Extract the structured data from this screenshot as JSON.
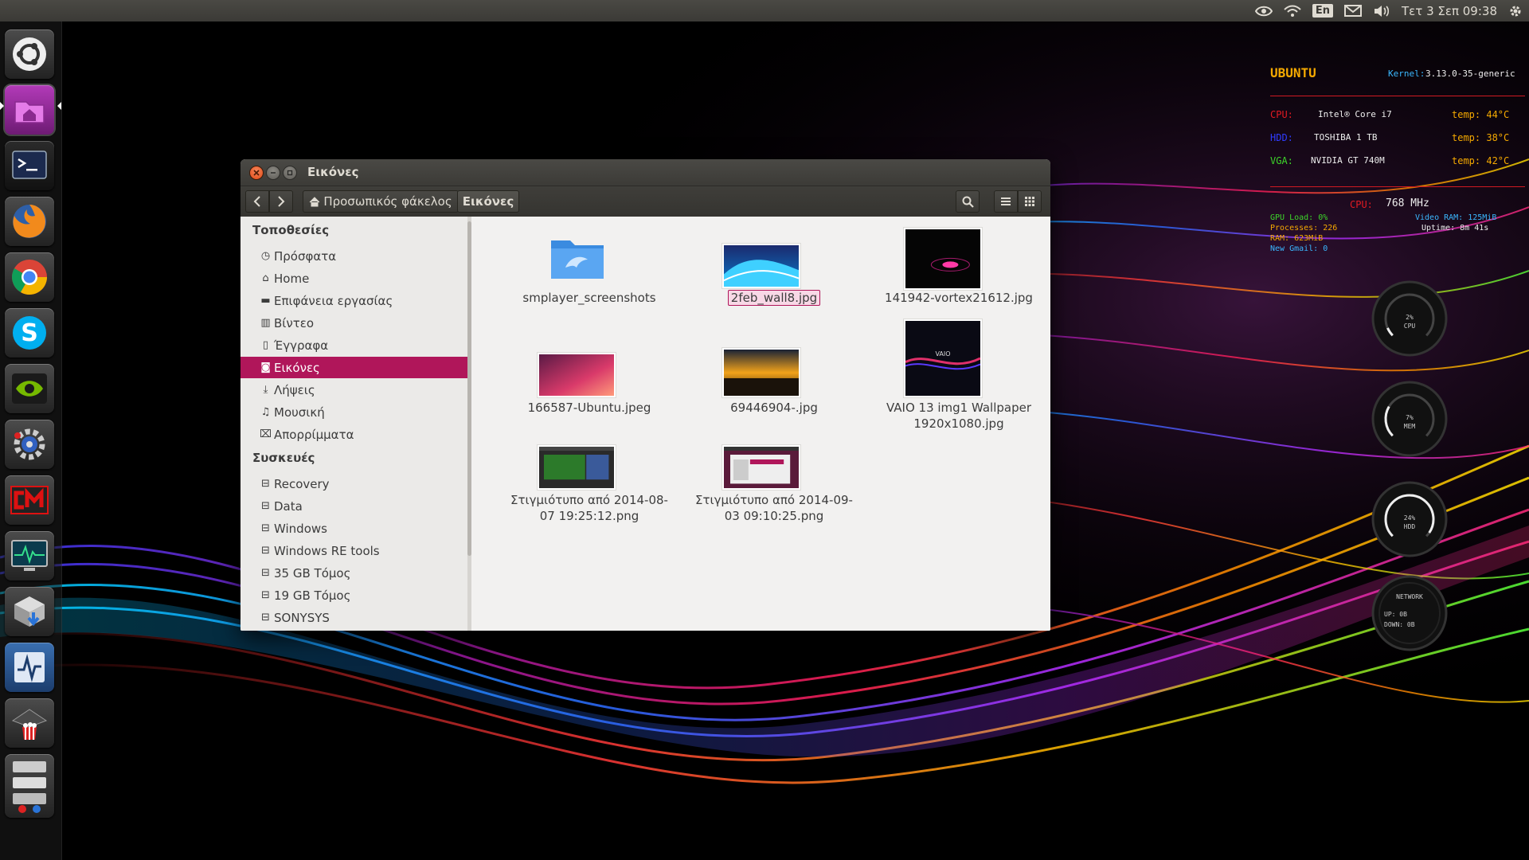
{
  "panel": {
    "lang": "En",
    "clock": "Τετ 3 Σεπ 09:38"
  },
  "launcher": {
    "items": [
      {
        "name": "dash-icon"
      },
      {
        "name": "files-icon"
      },
      {
        "name": "terminal-icon"
      },
      {
        "name": "firefox-icon"
      },
      {
        "name": "chrome-icon"
      },
      {
        "name": "skype-icon"
      },
      {
        "name": "nvidia-icon"
      },
      {
        "name": "system-settings-icon"
      },
      {
        "name": "cm-icon"
      },
      {
        "name": "system-monitor-icon"
      },
      {
        "name": "installer-icon"
      },
      {
        "name": "activity-monitor-icon"
      },
      {
        "name": "popcorn-icon"
      },
      {
        "name": "hardware-icon"
      }
    ]
  },
  "conky": {
    "os": "UBUNTU",
    "kernel_label": "Kernel:",
    "kernel": "3.13.0-35-generic",
    "cpu_label": "CPU:",
    "cpu": "Intel® Core i7",
    "cpu_temp": "temp: 44°C",
    "hdd_label": "HDD:",
    "hdd": "TOSHIBA 1 TB",
    "hdd_temp": "temp: 38°C",
    "vga_label": "VGA:",
    "vga": "NVIDIA GT 740M",
    "vga_temp": "temp: 42°C",
    "cpu_freq_label": "CPU:",
    "cpu_freq": "768 MHz",
    "gpu_load": "GPU Load: 0%",
    "video_ram": "Video RAM: 125MiB",
    "processes": "Processes: 226",
    "uptime": "Uptime: 8m 41s",
    "ram": "RAM: 623MiB",
    "gmail": "New Gmail: 0",
    "gauges": [
      {
        "label": "CPU",
        "value": "2%",
        "fraction": 0.02
      },
      {
        "label": "MEM",
        "value": "7%",
        "fraction": 0.07
      },
      {
        "label": "HDD",
        "value": "24%",
        "fraction": 0.24
      }
    ],
    "network": {
      "label": "NETWORK",
      "up": "UP: 0B",
      "down": "DOWN: 0B"
    }
  },
  "window": {
    "title": "Εικόνες",
    "breadcrumb": {
      "home": "Προσωπικός φάκελος",
      "current": "Εικόνες"
    },
    "sidebar": {
      "places_heading": "Τοποθεσίες",
      "places": [
        {
          "label": "Πρόσφατα",
          "icon": "clock-icon"
        },
        {
          "label": "Home",
          "icon": "home-icon"
        },
        {
          "label": "Επιφάνεια εργασίας",
          "icon": "folder-icon"
        },
        {
          "label": "Βίντεο",
          "icon": "film-icon"
        },
        {
          "label": "Έγγραφα",
          "icon": "document-icon"
        },
        {
          "label": "Εικόνες",
          "icon": "camera-icon"
        },
        {
          "label": "Λήψεις",
          "icon": "download-icon"
        },
        {
          "label": "Μουσική",
          "icon": "music-icon"
        },
        {
          "label": "Απορρίμματα",
          "icon": "trash-icon"
        }
      ],
      "devices_heading": "Συσκευές",
      "devices": [
        {
          "label": "Recovery"
        },
        {
          "label": "Data"
        },
        {
          "label": "Windows"
        },
        {
          "label": "Windows RE tools"
        },
        {
          "label": "35 GB Τόμος"
        },
        {
          "label": "19 GB Τόμος"
        },
        {
          "label": "SONYSYS"
        }
      ]
    },
    "files": [
      {
        "name": "smplayer_screenshots",
        "type": "folder"
      },
      {
        "name": "2feb_wall8.jpg",
        "type": "image",
        "selected": true
      },
      {
        "name": "141942-vortex21612.jpg",
        "type": "image"
      },
      {
        "name": "166587-Ubuntu.jpeg",
        "type": "image"
      },
      {
        "name": "69446904-.jpg",
        "type": "image"
      },
      {
        "name": "VAIO 13 img1 Wallpaper 1920x1080.jpg",
        "type": "image",
        "thumb_text": "VAIO"
      },
      {
        "name": "Στιγμιότυπο από 2014-08-07 19:25:12.png",
        "type": "image"
      },
      {
        "name": "Στιγμιότυπο από 2014-09-03 09:10:25.png",
        "type": "image"
      }
    ]
  }
}
